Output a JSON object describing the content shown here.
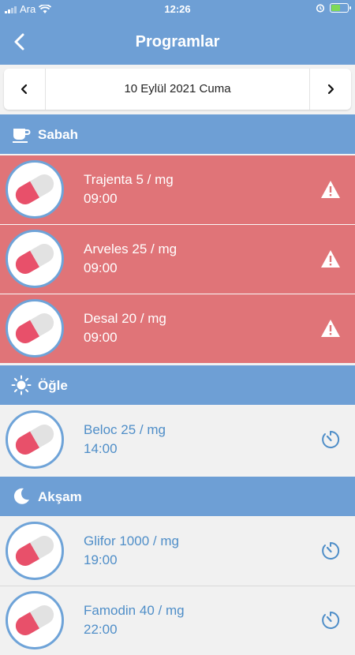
{
  "status_bar": {
    "carrier": "Ara",
    "time": "12:26",
    "battery_level": 0.65
  },
  "header": {
    "title": "Programlar"
  },
  "date_nav": {
    "date": "10 Eylül 2021 Cuma"
  },
  "sections": [
    {
      "label": "Sabah",
      "icon": "coffee-cup-icon",
      "medications": [
        {
          "name": "Trajenta 5 / mg",
          "time": "09:00",
          "status": "missed",
          "status_icon": "warning-icon"
        },
        {
          "name": "Arveles 25 / mg",
          "time": "09:00",
          "status": "missed",
          "status_icon": "warning-icon"
        },
        {
          "name": "Desal 20 / mg",
          "time": "09:00",
          "status": "missed",
          "status_icon": "warning-icon"
        }
      ]
    },
    {
      "label": "Öğle",
      "icon": "sun-icon",
      "medications": [
        {
          "name": "Beloc 25 / mg",
          "time": "14:00",
          "status": "pending",
          "status_icon": "timer-icon"
        }
      ]
    },
    {
      "label": "Akşam",
      "icon": "moon-icon",
      "medications": [
        {
          "name": "Glifor 1000 / mg",
          "time": "19:00",
          "status": "pending",
          "status_icon": "timer-icon"
        },
        {
          "name": "Famodin 40 / mg",
          "time": "22:00",
          "status": "pending",
          "status_icon": "timer-icon"
        }
      ]
    }
  ],
  "colors": {
    "header": "#6e9fd5",
    "alert_row": "#e07478",
    "normal_row": "#f1f1f1",
    "accent_text": "#4f8ec8",
    "pill_red": "#e8506a"
  }
}
